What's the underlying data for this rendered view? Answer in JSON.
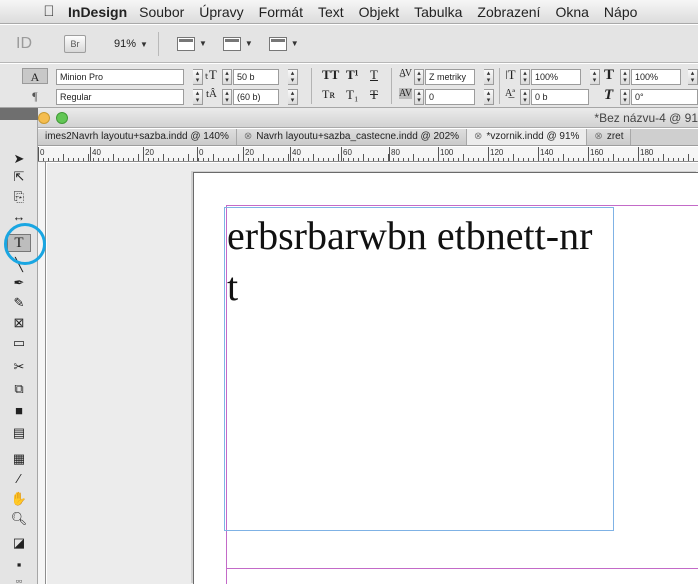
{
  "menubar": {
    "app_name": "InDesign",
    "items": [
      "Soubor",
      "Úpravy",
      "Formát",
      "Text",
      "Objekt",
      "Tabulka",
      "Zobrazení",
      "Okna",
      "Nápo"
    ]
  },
  "appbar": {
    "logo": "ID",
    "bridge_label": "Br",
    "zoom": "91%"
  },
  "control_panel": {
    "mode_char": "A",
    "mode_para": "¶",
    "font_family": "Minion Pro",
    "font_style": "Regular",
    "font_size": "50 b",
    "leading": "(60 b)",
    "kerning": "Z metriky",
    "tracking": "0",
    "vertical_scale": "100%",
    "horizontal_scale": "100%",
    "baseline_shift": "0 b",
    "skew": "0°"
  },
  "document": {
    "window_title": "*Bez názvu-4 @ 91",
    "tabs": [
      "imes2Navrh layoutu+sazba.indd @ 140%",
      "Navrh layoutu+sazba_castecne.indd @ 202%",
      "*vzornik.indd @ 91%",
      "zret"
    ],
    "ruler_labels": [
      "0",
      "40",
      "20",
      "0",
      "20",
      "40",
      "60",
      "80",
      "100",
      "120",
      "140",
      "160",
      "180"
    ],
    "text_content": "erbsrbarwbn etbnett-nr t"
  },
  "colors": {
    "highlight": "#19a6e2",
    "margin_guide": "#c36ac8",
    "frame_edge": "#7fb2e5"
  }
}
